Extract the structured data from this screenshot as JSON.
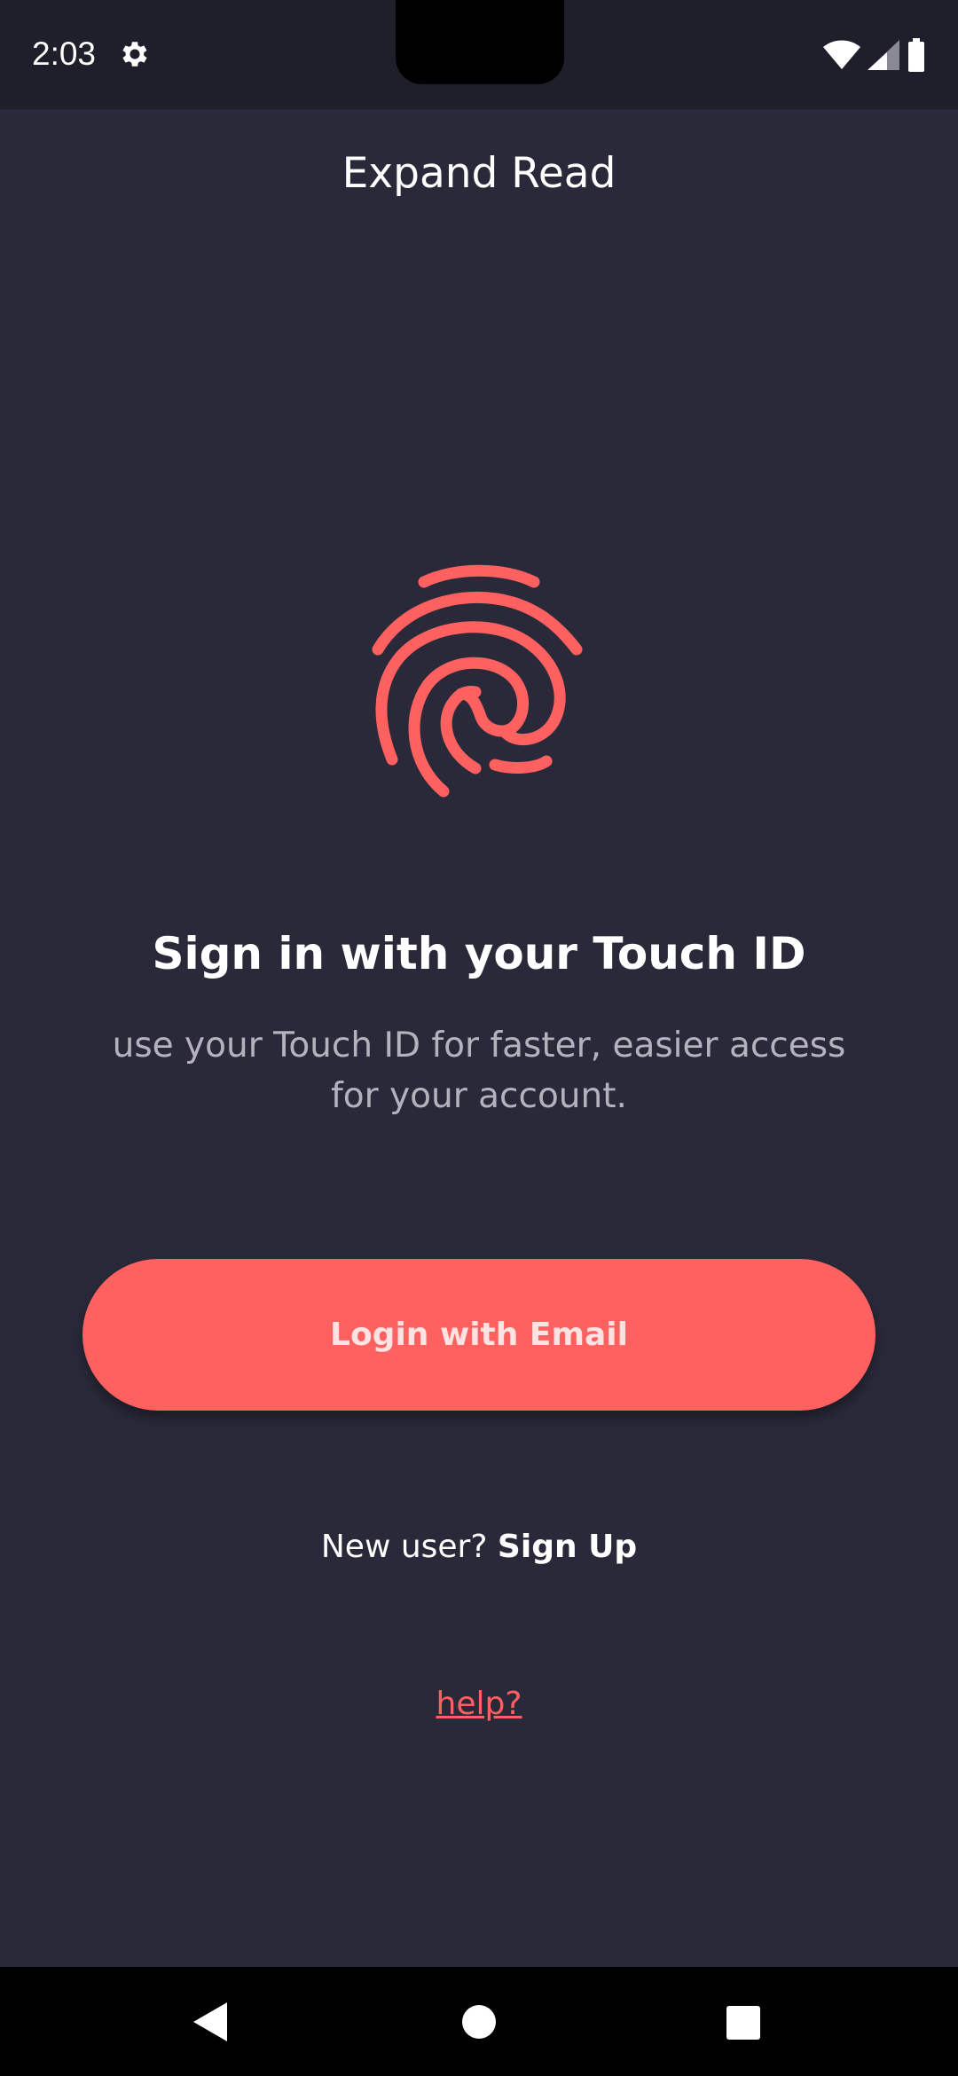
{
  "status_bar": {
    "time": "2:03",
    "icons": [
      "gear-icon",
      "wifi-icon",
      "signal-icon",
      "battery-icon"
    ]
  },
  "header": {
    "title": "Expand Read"
  },
  "main": {
    "icon": "fingerprint-icon",
    "title": "Sign in with your Touch ID",
    "subtitle": "use your Touch ID for faster, easier access for your account.",
    "login_button": "Login with Email",
    "new_user_prefix": "New user?",
    "sign_up_label": "Sign Up",
    "help_label": "help?"
  },
  "nav_bar": {
    "icons": [
      "back-icon",
      "home-icon",
      "recents-icon"
    ]
  },
  "colors": {
    "background": "#2a2939",
    "status_bar": "#1f1e2b",
    "accent": "#ff6161",
    "text": "#ffffff",
    "muted_text": "#b3b2bd"
  }
}
